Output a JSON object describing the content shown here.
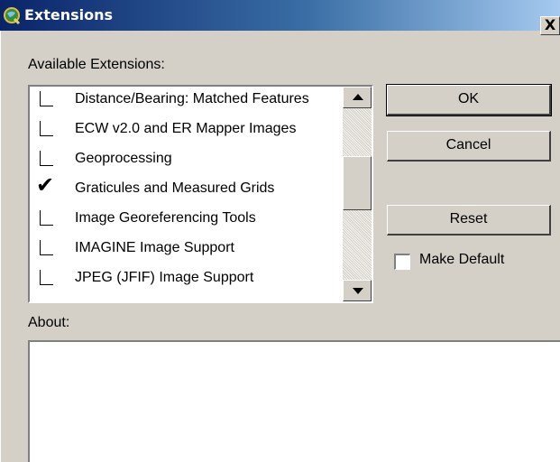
{
  "window": {
    "title": "Extensions",
    "close_label": "X"
  },
  "available_label": "Available Extensions:",
  "extensions": [
    {
      "label": "Distance/Bearing:  Matched Features",
      "checked": false
    },
    {
      "label": "ECW v2.0 and ER Mapper Images",
      "checked": false
    },
    {
      "label": "Geoprocessing",
      "checked": false
    },
    {
      "label": "Graticules and Measured Grids",
      "checked": true
    },
    {
      "label": "Image Georeferencing Tools",
      "checked": false
    },
    {
      "label": "IMAGINE Image Support",
      "checked": false
    },
    {
      "label": "JPEG (JFIF) Image Support",
      "checked": false
    }
  ],
  "buttons": {
    "ok": "OK",
    "cancel": "Cancel",
    "reset": "Reset"
  },
  "make_default": {
    "label": "Make Default",
    "checked": false
  },
  "about": {
    "label": "About:",
    "text": ""
  },
  "colors": {
    "titlebar_start": "#0a246a",
    "titlebar_end": "#a6caf0",
    "dialog_bg": "#d4d0c8"
  }
}
